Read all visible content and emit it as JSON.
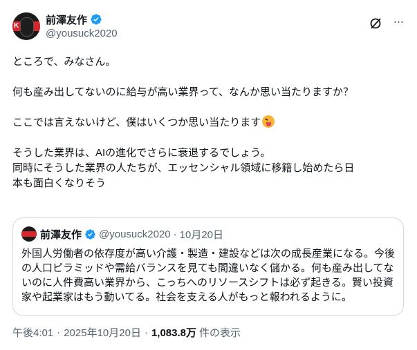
{
  "author": {
    "display_name": "前澤友作",
    "handle": "@yousuck2020",
    "avatar_text": "K"
  },
  "icons": {
    "verified": "verified-badge-icon",
    "grok": "grok-icon",
    "more": "more-options-icon"
  },
  "colors": {
    "verified_blue": "#1d9bf0",
    "secondary_text": "#536471",
    "border": "#cfd9de"
  },
  "tweet": {
    "lines": [
      "ところで、みなさん。",
      "",
      "何も産み出してないのに給与が高い業界って、なんか思い当たりますか？",
      "",
      "ここでは言えないけど、僕はいくつか思い当たります",
      "",
      "そうした業界は、AIの進化でさらに衰退するでしょう。",
      "同時にそうした業界の人たちが、エッセンシャル領域に移籍し始めたら日",
      "本も面白くなりそう"
    ]
  },
  "quoted": {
    "display_name": "前澤友作",
    "handle": "@yousuck2020",
    "separator": "·",
    "date": "10月20日",
    "lines": [
      "外国人労働者の依存度が高い介護・製造・建設などは次の成長産業になる。今後",
      "の人口ピラミッドや需給バランスを見ても間違いなく儲かる。何も産み出してな",
      "いのに人件費高い業界から、こっちへのリソースシフトは必ず起きる。賢い投資",
      "家や起業家はもう動いてる。社会を支える人がもっと報われるように。"
    ]
  },
  "meta": {
    "time": "午後4:01",
    "separator": "·",
    "date": "2025年10月20日",
    "views": "1,083.8万",
    "views_label": "件の表示"
  }
}
